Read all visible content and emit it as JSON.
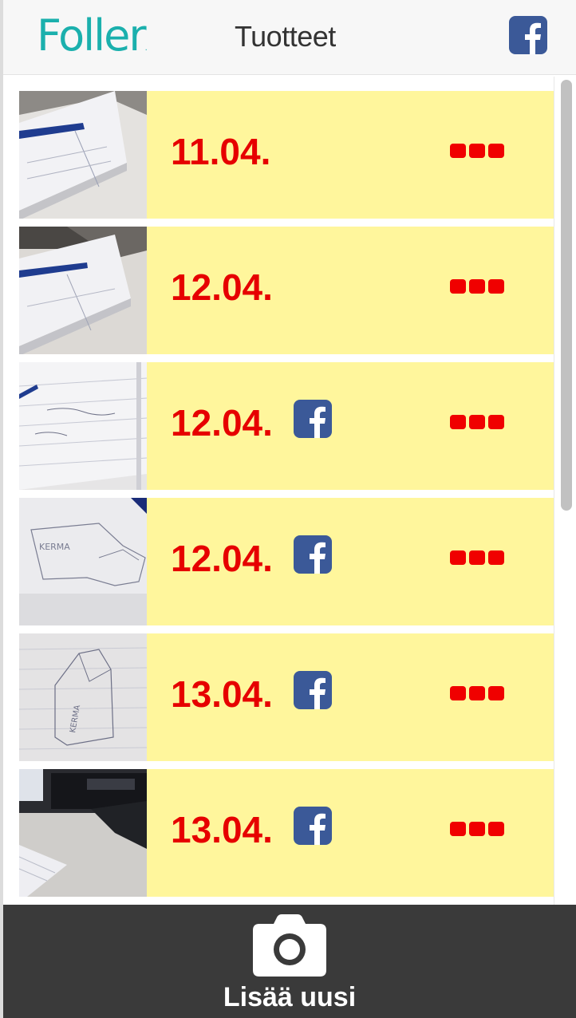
{
  "header": {
    "logo_text": "Foller",
    "title": "Tuotteet",
    "facebook_icon": "facebook-icon"
  },
  "items": [
    {
      "date": "11.04.",
      "facebook": false,
      "thumb": "photo-notebook-blue-pen"
    },
    {
      "date": "12.04.",
      "facebook": false,
      "thumb": "photo-notebook-blue-pen"
    },
    {
      "date": "12.04.",
      "facebook": true,
      "thumb": "photo-lined-notebook-writing"
    },
    {
      "date": "12.04.",
      "facebook": true,
      "thumb": "photo-sketch-tag"
    },
    {
      "date": "13.04.",
      "facebook": true,
      "thumb": "photo-sketch-vertical-tag"
    },
    {
      "date": "13.04.",
      "facebook": true,
      "thumb": "photo-desk-monitor"
    }
  ],
  "footer": {
    "label": "Lisää uusi",
    "icon": "camera-icon"
  },
  "colors": {
    "brand": "#1bb0ad",
    "item_background": "#fff69c",
    "date_text": "#e60000",
    "menu_dots": "#f00000",
    "facebook": "#3b5998",
    "footer_background": "#3a3a3a"
  }
}
